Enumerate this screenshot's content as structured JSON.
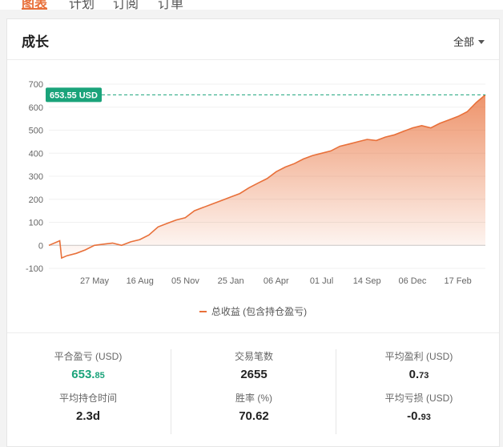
{
  "tabs": [
    {
      "label": "图表",
      "active": true
    },
    {
      "label": "计划",
      "active": false
    },
    {
      "label": "订阅",
      "active": false
    },
    {
      "label": "订单",
      "active": false
    }
  ],
  "card": {
    "title": "成长",
    "range_label": "全部"
  },
  "chart_data": {
    "type": "area",
    "y_ticks": [
      700,
      600,
      500,
      400,
      300,
      200,
      100,
      0,
      -100
    ],
    "ylim": [
      -100,
      700
    ],
    "x_ticks": [
      "27 May",
      "16 Aug",
      "05 Nov",
      "25 Jan",
      "06 Apr",
      "01 Jul",
      "14 Sep",
      "06 Dec",
      "17 Feb"
    ],
    "current_value_label": "653.55 USD",
    "current_value": 653.55,
    "series": [
      {
        "name": "总收益 (包含持仓盈亏)",
        "color": "#e8703a",
        "x": [
          0,
          1.2,
          1.4,
          2,
          3,
          4,
          5,
          6,
          7,
          8,
          9,
          10,
          11,
          12,
          13,
          14,
          15,
          16,
          17,
          18,
          19,
          20,
          21,
          22,
          23,
          24,
          25,
          26,
          27,
          28,
          29,
          30,
          31,
          32,
          33,
          34,
          35,
          36,
          37,
          38,
          39,
          40,
          41,
          42,
          43,
          44,
          45,
          46,
          47,
          48
        ],
        "values": [
          0,
          20,
          -55,
          -45,
          -35,
          -20,
          0,
          5,
          10,
          0,
          15,
          25,
          45,
          80,
          95,
          110,
          120,
          150,
          165,
          180,
          195,
          210,
          225,
          250,
          270,
          290,
          320,
          340,
          355,
          375,
          390,
          400,
          410,
          430,
          440,
          450,
          460,
          455,
          470,
          480,
          495,
          510,
          520,
          510,
          530,
          545,
          560,
          580,
          620,
          653.55
        ]
      }
    ],
    "legend_placement": "bottom",
    "grid": true
  },
  "stats": [
    {
      "label": "平合盈亏 (USD)",
      "value": "653.",
      "value_small": "85",
      "color": "green"
    },
    {
      "label": "交易笔数",
      "value": "2655",
      "value_small": "",
      "color": "default"
    },
    {
      "label": "平均盈利 (USD)",
      "value": "0.",
      "value_small": "73",
      "color": "default"
    },
    {
      "label": "平均持仓时间",
      "value": "2.3d",
      "value_small": "",
      "color": "default"
    },
    {
      "label": "胜率 (%)",
      "value": "70.62",
      "value_small": "",
      "color": "default"
    },
    {
      "label": "平均亏损 (USD)",
      "value": "-0.",
      "value_small": "93",
      "color": "default"
    }
  ]
}
